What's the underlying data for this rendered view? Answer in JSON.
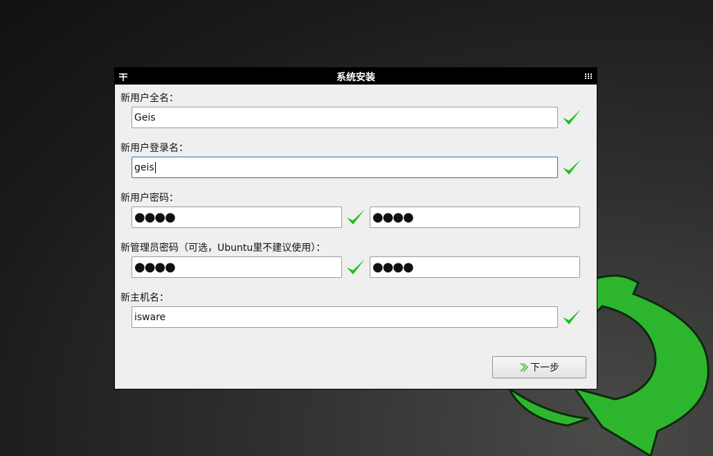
{
  "window": {
    "title": "系统安装"
  },
  "form": {
    "fullname_label": "新用户全名：",
    "fullname_value": "Geis",
    "login_label": "新用户登录名：",
    "login_value": "geis",
    "password_label": "新用户密码：",
    "password_value": "●●●●",
    "password_confirm_value": "●●●●",
    "admin_password_label": "新管理员密码（可选，Ubuntu里不建议使用）：",
    "admin_password_value": "●●●●",
    "admin_password_confirm_value": "●●●●",
    "hostname_label": "新主机名：",
    "hostname_value": "isware"
  },
  "buttons": {
    "next_label": "下一步"
  },
  "colors": {
    "check": "#1fbf1f",
    "arrow": "#2db62d"
  },
  "icons": [
    "pin-icon",
    "menu-icon",
    "checkmark-icon",
    "double-chevron-right-icon",
    "refresh-arrow-icon"
  ]
}
